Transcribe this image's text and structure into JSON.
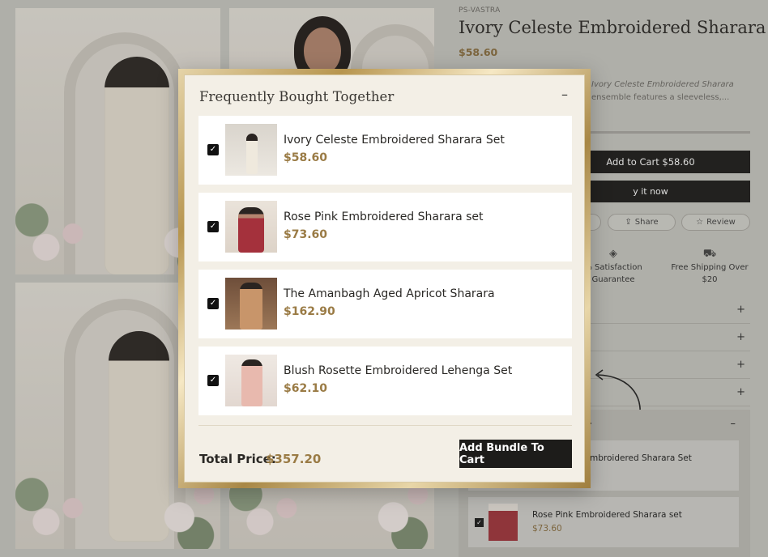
{
  "product": {
    "brand": "PS-VASTRA",
    "title": "Ivory Celeste Embroidered Sharara Set",
    "price": "$58.60",
    "description_line1": "Ivory Celeste Embroidered Sharara",
    "description_line2": "ensemble features a sleeveless,...",
    "add_to_cart_label": "Add to Cart $58.60",
    "buy_now_label": "y it now",
    "share_label": "Share",
    "review_label": "Review",
    "features": [
      {
        "icon": "satisfaction-icon",
        "line1": "% Satisfaction",
        "line2": "Guarantee"
      },
      {
        "icon": "truck-icon",
        "line1": "Free Shipping Over",
        "line2": "$20"
      }
    ],
    "accordion_plus": "+"
  },
  "background_fbt": {
    "header_fragment": "er",
    "collapse": "–",
    "items": [
      {
        "name": "mbroidered Sharara Set"
      },
      {
        "name": "Rose Pink Embroidered Sharara set",
        "price": "$73.60"
      }
    ]
  },
  "modal": {
    "title": "Frequently Bought Together",
    "collapse_symbol": "–",
    "items": [
      {
        "name": "Ivory Celeste Embroidered Sharara Set",
        "price": "$58.60",
        "checked": true
      },
      {
        "name": "Rose Pink Embroidered Sharara set",
        "price": "$73.60",
        "checked": true
      },
      {
        "name": "The Amanbagh Aged Apricot Sharara",
        "price": "$162.90",
        "checked": true
      },
      {
        "name": "Blush Rosette Embroidered Lehenga Set",
        "price": "$62.10",
        "checked": true
      }
    ],
    "total_label": "Total Price:",
    "total_value": "$357.20",
    "add_bundle_label": "Add Bundle To Cart"
  },
  "colors": {
    "accent_gold": "#9a7b45",
    "button_dark": "#1d1c1a",
    "modal_bg": "#f3efe6"
  }
}
